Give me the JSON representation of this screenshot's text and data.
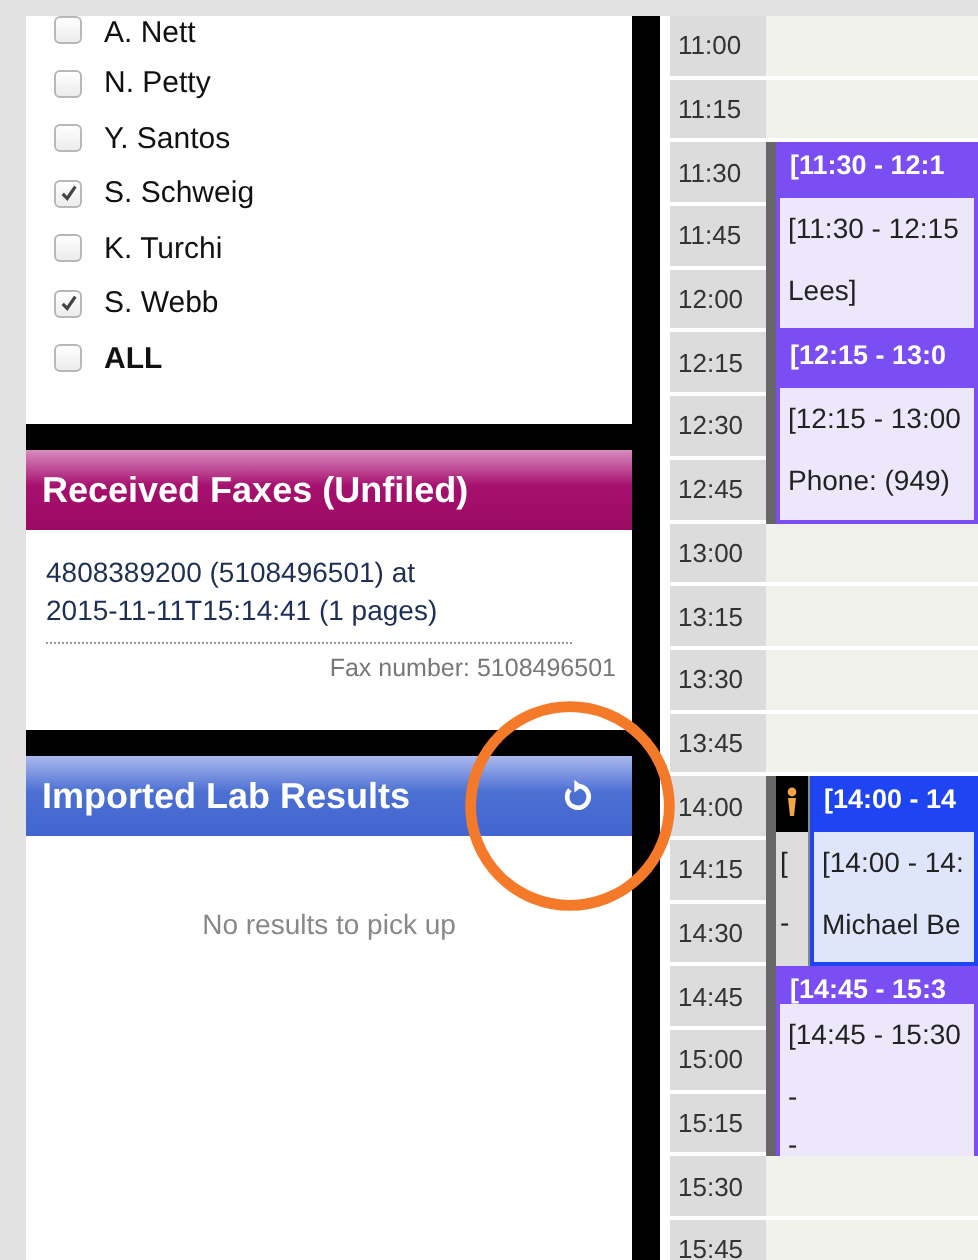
{
  "providers": [
    {
      "label": "A. Nett",
      "checked": false
    },
    {
      "label": "N. Petty",
      "checked": false
    },
    {
      "label": "Y. Santos",
      "checked": false
    },
    {
      "label": "S. Schweig",
      "checked": true
    },
    {
      "label": "K. Turchi",
      "checked": false
    },
    {
      "label": "S. Webb",
      "checked": true
    },
    {
      "label": "ALL",
      "checked": false
    }
  ],
  "faxes": {
    "title": "Received Faxes (Unfiled)",
    "items": [
      {
        "text": "4808389200 (5108496501) at 2015-11-11T15:14:41 (1 pages)",
        "fax_number": "Fax number: 5108496501"
      }
    ]
  },
  "lab_results": {
    "title": "Imported Lab Results",
    "empty_text": "No results to pick up"
  },
  "calendar": {
    "rows": [
      {
        "time": "11:00"
      },
      {
        "time": "11:15"
      },
      {
        "time": "11:30",
        "event": {
          "kind": "single",
          "color": "#7b4ef3",
          "header": "[11:30 - 12:1",
          "lines": [
            "[11:30 - 12:15",
            "Lees]"
          ]
        }
      },
      {
        "time": "11:45"
      },
      {
        "time": "12:00"
      },
      {
        "time": "12:15",
        "event": {
          "kind": "single",
          "color": "#7b4ef3",
          "header": "[12:15 - 13:0",
          "lines": [
            "[12:15 - 13:00",
            "Phone: (949)"
          ]
        }
      },
      {
        "time": "12:30"
      },
      {
        "time": "12:45"
      },
      {
        "time": "13:00"
      },
      {
        "time": "13:15"
      },
      {
        "time": "13:30"
      },
      {
        "time": "13:45"
      },
      {
        "time": "14:00",
        "event": {
          "kind": "double",
          "color": "#1f44f2",
          "header": "[14:00 - 14",
          "lines": [
            "[14:00 - 14:",
            "Michael Be"
          ],
          "side_lines": [
            "[",
            "-"
          ]
        }
      },
      {
        "time": "14:15"
      },
      {
        "time": "14:30"
      },
      {
        "time": "14:45",
        "event": {
          "kind": "single",
          "color": "#7b4ef3",
          "header": "[14:45 - 15:3",
          "lines": [
            "[14:45 - 15:30",
            "-",
            "-"
          ]
        }
      },
      {
        "time": "15:00"
      },
      {
        "time": "15:15"
      },
      {
        "time": "15:30"
      },
      {
        "time": "15:45"
      }
    ]
  }
}
